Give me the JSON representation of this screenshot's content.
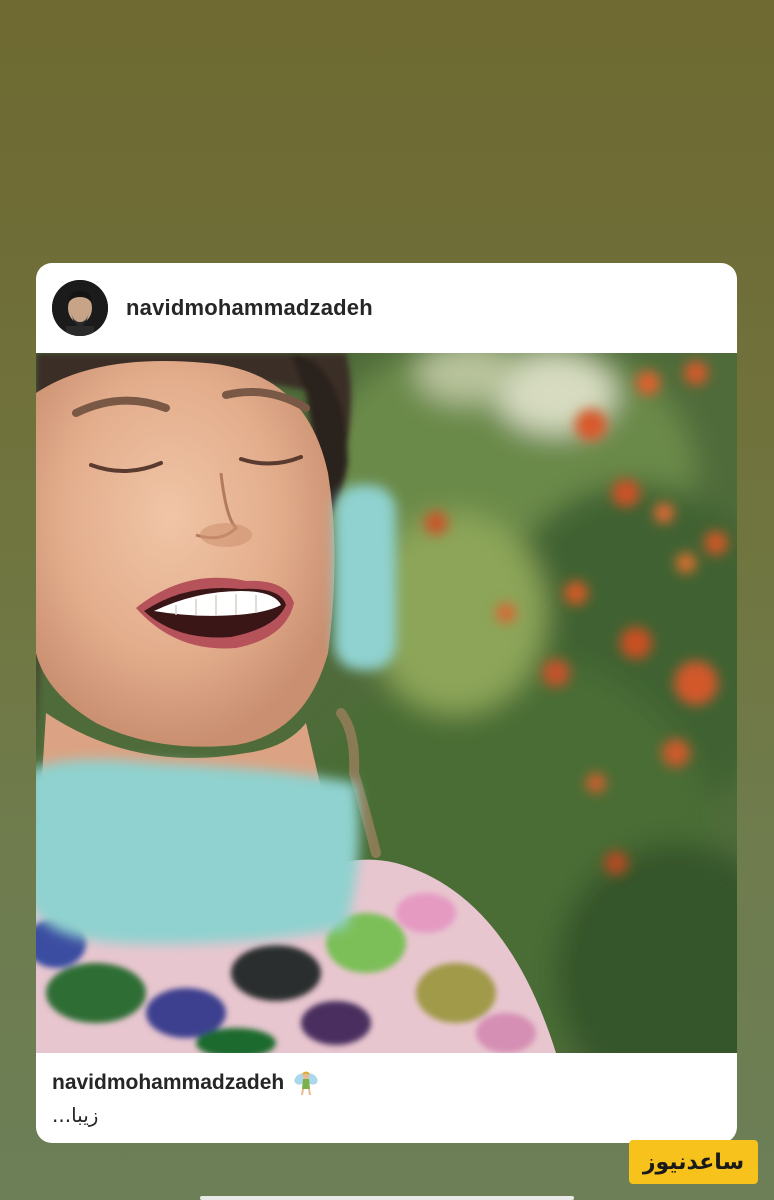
{
  "post": {
    "header_username": "navidmohammadzadeh",
    "caption_username": "navidmohammadzadeh",
    "caption_emoji_icon": "fairy-icon",
    "caption_text": "زیبا..."
  },
  "watermark": {
    "text": "ساعدنیوز",
    "color": "#f7c21b"
  },
  "colors": {
    "story_background": "#6f7440",
    "card": "#ffffff",
    "censor_blur": "#8fd2cf"
  }
}
